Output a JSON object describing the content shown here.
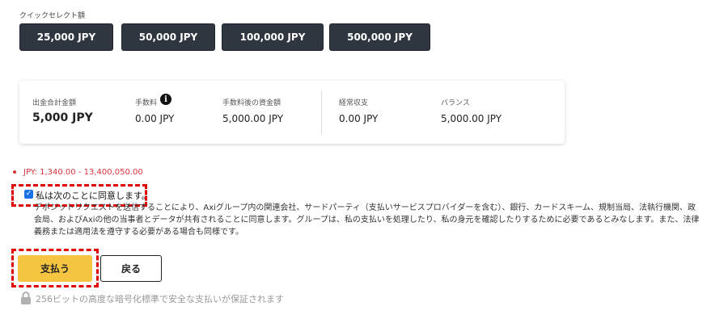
{
  "quick_select": {
    "label": "クイックセレクト額",
    "buttons": [
      "25,000 JPY",
      "50,000 JPY",
      "100,000 JPY",
      "500,000 JPY"
    ]
  },
  "summary": {
    "total_deposit": {
      "label": "出金合計金額",
      "value": "5,000 JPY"
    },
    "fee": {
      "label": "手数料",
      "value": "0.00 JPY",
      "icon": "info-icon"
    },
    "after_fee": {
      "label": "手数料後の資金額",
      "value": "5,000.00 JPY"
    },
    "balance_change": {
      "label": "経常収支",
      "value": "0.00 JPY"
    },
    "balance": {
      "label": "バランス",
      "value": "5,000.00 JPY"
    }
  },
  "range": "JPY: 1,340.00 - 13,400,050.00",
  "agreement": {
    "label": "私は次のことに同意します。",
    "checked": true,
    "terms": [
      "デポジットリクエストを送信することにより、Axiグループ内の関連会社、サードパーティ（支払いサービスプロバイダーを含む）、銀行、カードスキーム、規制当局、法執行機関、政",
      "会局、およびAxiの他の当事者とデータが共有されることに同意します。グループは、私の支払いを処理したり、私の身元を確認したりするために必要であるとみなします。また、法律",
      "義務または適用法を遵守する必要がある場合も同様です。"
    ]
  },
  "actions": {
    "pay": "支払う",
    "back": "戻る"
  },
  "secure_note": "256ビットの高度な暗号化標準で安全な支払いが保証されます",
  "colors": {
    "dark_button": "#2f3640",
    "accent_yellow": "#f5c542",
    "error_red": "#d9343c",
    "highlight_red": "#e00000"
  }
}
